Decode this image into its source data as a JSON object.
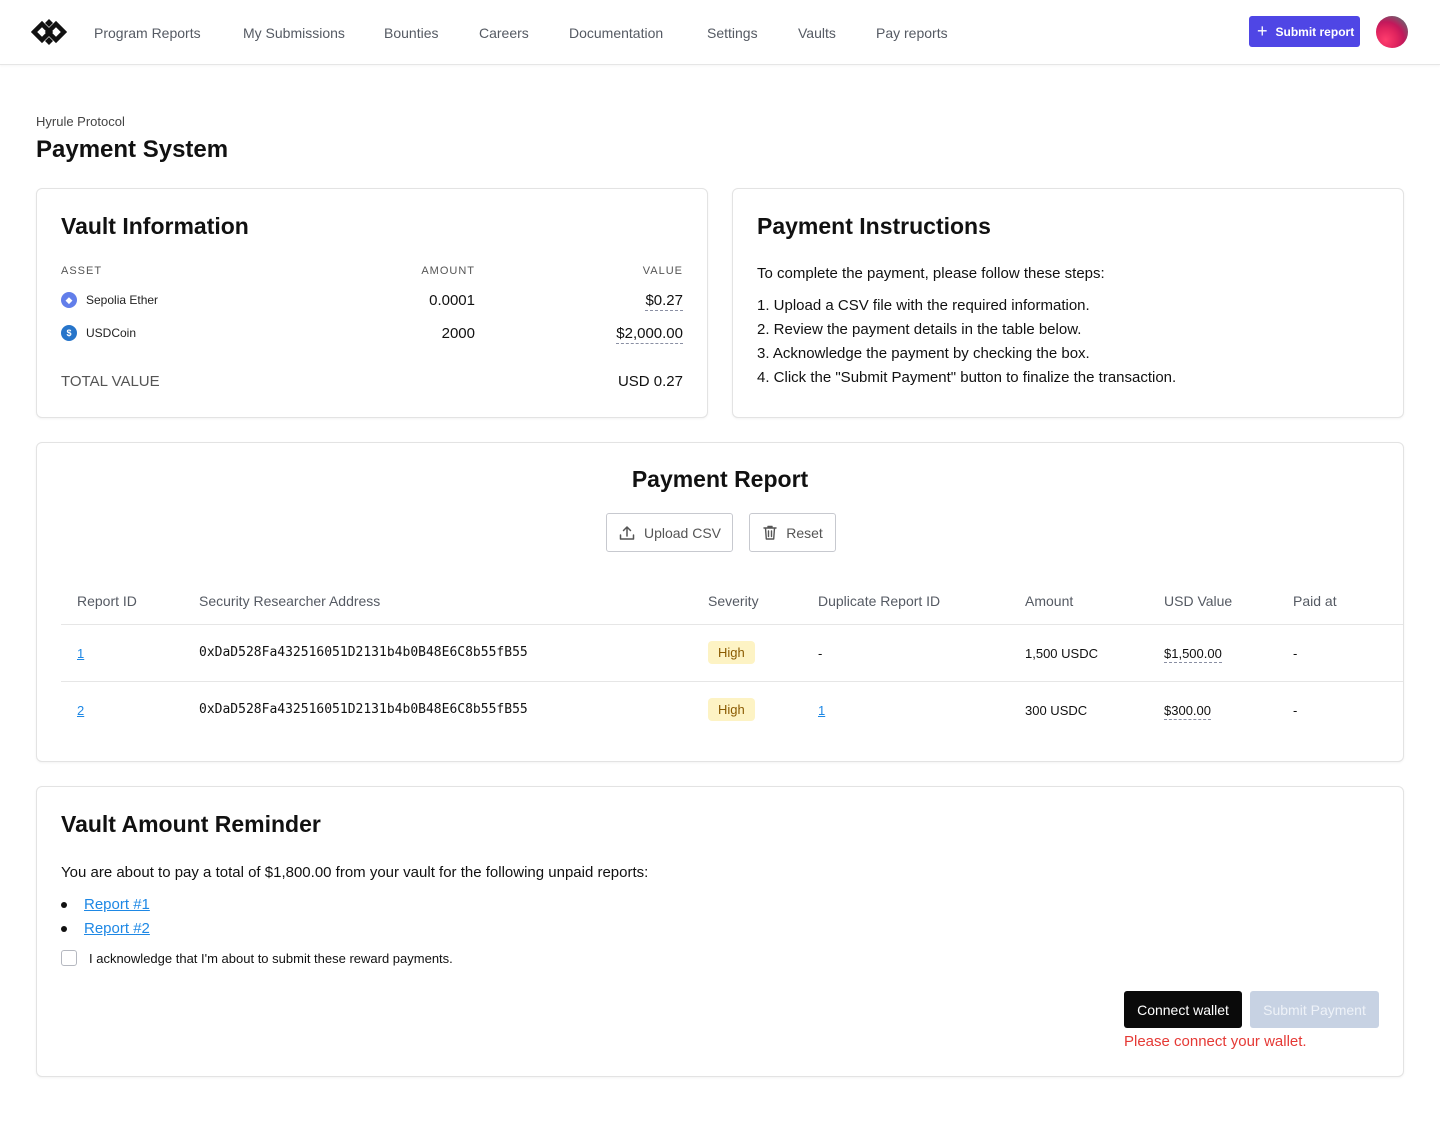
{
  "nav": {
    "items": [
      {
        "label": "Program Reports"
      },
      {
        "label": "My Submissions"
      },
      {
        "label": "Bounties"
      },
      {
        "label": "Careers"
      },
      {
        "label": "Documentation"
      },
      {
        "label": "Settings"
      },
      {
        "label": "Vaults"
      },
      {
        "label": "Pay reports"
      }
    ],
    "submit_report_label": "Submit report",
    "accent_color": "#4f46e5"
  },
  "page": {
    "breadcrumb": "Hyrule Protocol",
    "title": "Payment System"
  },
  "vault_info": {
    "title": "Vault Information",
    "headers": {
      "asset": "ASSET",
      "amount": "AMOUNT",
      "value": "VALUE"
    },
    "rows": [
      {
        "asset": "Sepolia Ether",
        "icon": "ethereum-icon",
        "amount": "0.0001",
        "value": "$0.27"
      },
      {
        "asset": "USDCoin",
        "icon": "usdc-icon",
        "amount": "2000",
        "value": "$2,000.00"
      }
    ],
    "total_label": "TOTAL VALUE",
    "total_value": "USD 0.27"
  },
  "instructions": {
    "title": "Payment Instructions",
    "intro": "To complete the payment, please follow these steps:",
    "steps": [
      "1. Upload a CSV file with the required information.",
      "2. Review the payment details in the table below.",
      "3. Acknowledge the payment by checking the box.",
      "4. Click the \"Submit Payment\" button to finalize the transaction."
    ]
  },
  "payment_report": {
    "title": "Payment Report",
    "upload_label": "Upload CSV",
    "reset_label": "Reset",
    "columns": [
      "Report ID",
      "Security Researcher Address",
      "Severity",
      "Duplicate Report ID",
      "Amount",
      "USD Value",
      "Paid at"
    ],
    "rows": [
      {
        "report_id": "1",
        "address": "0xDaD528Fa432516051D2131b4b0B48E6C8b55fB55",
        "severity": "High",
        "duplicate": "-",
        "amount": "1,500 USDC",
        "usd_value": "$1,500.00",
        "paid_at": "-"
      },
      {
        "report_id": "2",
        "address": "0xDaD528Fa432516051D2131b4b0B48E6C8b55fB55",
        "severity": "High",
        "duplicate": "1",
        "amount": "300 USDC",
        "usd_value": "$300.00",
        "paid_at": "-"
      }
    ]
  },
  "reminder": {
    "title": "Vault Amount Reminder",
    "text": "You are about to pay a total of $1,800.00 from your vault for the following unpaid reports:",
    "reports": [
      "Report #1",
      "Report #2"
    ],
    "acknowledge": "I acknowledge that I'm about to submit these reward payments.",
    "connect_label": "Connect wallet",
    "submit_label": "Submit Payment",
    "error": "Please connect your wallet."
  }
}
